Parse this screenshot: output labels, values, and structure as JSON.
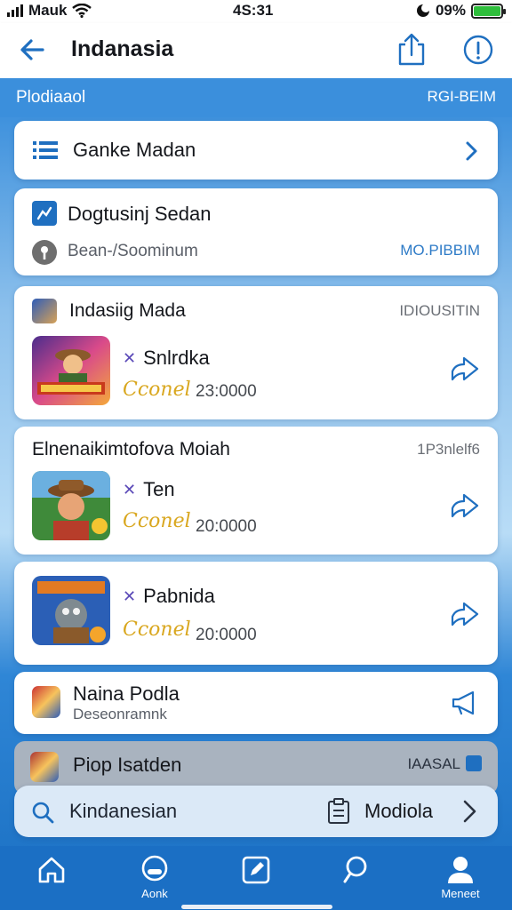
{
  "status_bar": {
    "carrier": "Mauk",
    "time": "4S:31",
    "battery": "09%"
  },
  "header": {
    "title": "Indanasia"
  },
  "section": {
    "left": "Plodiaaol",
    "right": "RGI-BEIM"
  },
  "nav_card": {
    "label": "Ganke Madan"
  },
  "doc_card": {
    "title": "Dogtusinj Sedan",
    "subtitle": "Bean-/Soominum",
    "right": "MO.PIBBIM"
  },
  "game_section_1": {
    "header": "Indasiig Mada",
    "right": "IDIOUSITIN",
    "game": {
      "name": "Snlrdka",
      "coin_label": "Cconel",
      "coin_value": "23:0000"
    }
  },
  "game_section_2": {
    "header": "Elnenaikimtofova Moiah",
    "right": "1P3nlelf6",
    "game": {
      "name": "Ten",
      "coin_label": "Cconel",
      "coin_value": "20:0000"
    }
  },
  "game_card_3": {
    "name": "Pabnida",
    "coin_label": "Cconel",
    "coin_value": "20:0000"
  },
  "naina_card": {
    "title": "Naina Podla",
    "subtitle": "Deseonramnk"
  },
  "pinned_card": {
    "title": "Piop Isatden",
    "right": "IAASAL"
  },
  "search_bar": {
    "text": "Kindanesian",
    "mode_label": "Modiola"
  },
  "tab_bar": {
    "tab2_label": "Aonk",
    "tab5_label": "Meneet"
  },
  "colors": {
    "primary": "#1f6fc0",
    "tab_bar": "#1b6fc4",
    "coin": "#d9a71f"
  }
}
